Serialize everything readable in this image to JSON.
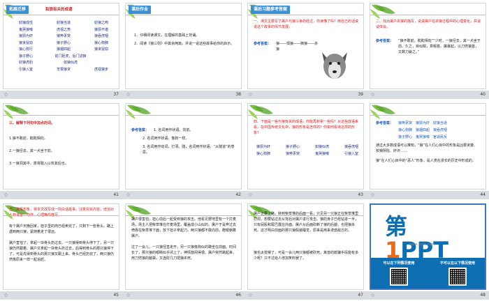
{
  "slides": [
    {
      "number": "37",
      "tag": "拓展迁移",
      "heading": "和狼有关的成语",
      "idioms": [
        [
          "豺狼成性",
          "豺狼当道",
          "豺狼之吻"
        ],
        [
          "鬼哭狼嚎",
          "虎视之势",
          "狼狈不堪"
        ],
        [
          "狼狈为奸",
          "狼奔豕突",
          "狼吞虎咽"
        ],
        [
          "狼贪鼠窃",
          "狼子野心",
          "狼心狗肺"
        ],
        [
          "狼心狗行",
          "狼烟四起",
          "狼贪鼠窃"
        ],
        [
          "狼子野心",
          "前门拒虎，后门进狼",
          ""
        ],
        [
          "豺狼虎豹",
          "如狼似虎",
          ""
        ],
        [
          "引狼入室",
          "羊狠狼贪",
          "虎视狼步"
        ]
      ],
      "idioms_col2": "如狼似虎"
    },
    {
      "number": "38",
      "tag": "课后作业",
      "lines": [
        "1．仔细阅读课文，在理解的基础上背诵。",
        "2．阅读《狼三则》中其余两篇，并说一说这些故事给你的启示。"
      ]
    },
    {
      "number": "39",
      "tag": "课后习题参考答案",
      "question": "一、课文主要写了屠户与狼斗争的经过，你读懂了吗？用自己的话说说这个故事的情节发展。",
      "answer_label": "参考答案：",
      "answer": "狼——惧狼——御狼——杀狼"
    },
    {
      "number": "40",
      "tag": "",
      "question": "二、找出屠户杀狼的描写，说说屠户在杀狼过程中的心理变化，并谈谈体会。",
      "answer_label": "参考答案：",
      "answer": "“狼不敢前，眈眈相向”“少时，一狼径去，其一犬坐于前。久之，目似瞑，意暇甚。屠暴起，以刀劈狼首，又数刀毙之。”"
    },
    {
      "number": "41",
      "tag": "",
      "question": "三、解释下列句中加点的词。",
      "lines": [
        "1.狼不敢前，眈眈相向。",
        "2.一狼径去，其一犬坐于前。",
        "3.一狼洞其中，意将隧入以攻其后也。"
      ]
    },
    {
      "number": "42",
      "tag": "",
      "answer_label": "参考答案：",
      "lines": [
        "1. 名词用作状语，向前。",
        "2. 名词用作状语，像狗一样。",
        "3. 名词用作动词，打洞。隧，名词用作状语，“从隧道”的意思。"
      ]
    },
    {
      "number": "43",
      "tag": "",
      "question": "四、下面是一些与狼有关的成语，你能再积累一些吗？从这些成语来看，在中国传统文化中，狼的形象是怎样的？你如何看待这样的形象？",
      "idioms": [
        [
          "狼狈为奸",
          "狼子野心",
          "如狼似虎",
          "狼吞虎咽"
        ],
        [
          "狼心狗肺",
          "狼奔豕突",
          "鬼哭狼嚎",
          "引狼入室"
        ]
      ]
    },
    {
      "number": "44",
      "tag": "",
      "answer_label": "参考答案：",
      "lines": [
        "狼奔豕突　狼狈为奸　豺狼当道",
        "狼心狗肺　狼烟四起　狼吞虎咽",
        "狼子野心　鬼哭狼嚎　官逼民反",
        "通过大多数成语可以推知，“狼”在人们心目中的形象是凶狠贪婪、狡猾阴险、奸诈……",
        "狼“在人们心目中的“恶人”形象，是人类在漫长的历史中形成的。"
      ]
    },
    {
      "number": "45",
      "tag": "",
      "question": "五、发挥想象，将本文改写成一则白话故事。注意充实内容，增加对人物语言、动作、心理等的描写。",
      "lines": [
        "有个屠户天晚回家，担子里的肉已经卖完了，只剩下一些骨头。路上遇到两只狼，紧随着走了很远。",
        "屠户害怕了，拿起一块骨头扔过去。一只狼得到骨头停下了，另一只狼仍然跟着。屠户又拿起一块骨头扔过去，后得到骨头的那只狼停下了，可是先得到骨头的那只狼又跟上来。骨头已经扔完了，两只狼仍然像原来一样一起追赶。"
      ]
    },
    {
      "number": "46",
      "tag": "",
      "lines": [
        "屠户很害怕，担心前后一起受到狼的攻击。他看见野地里有一个打麦场，场主人把柴草堆在打麦场里，覆盖成小山似的。屠户于是奔过去倚靠在柴草堆下面，放下担子拿起刀。两只狼都不敢向前，瞪眼朝着屠户。",
        "过了一会儿，一只狼径直走开，另一只狼像狗似的蹲坐在前面。时间长了，那只狼的眼睛似乎闭上了，神情悠闲得很。屠户突然跳起来，用刀劈狼的脑袋，又连砍几刀把狼杀死。"
      ]
    },
    {
      "number": "47",
      "tag": "",
      "lines": [
        "屠户正要上路，转到柴草堆的后面一看，只见另一只狼正在柴草堆里打洞，想要钻过去从背后对屠户进行攻击。狼的身子已经钻进一半，只有屁股和尾巴露在外面。屠户从后面砍断了狼的后腿，也把狼杀死。这才明白前面的那只狼假装睡觉，原来是用来诱惑敌方的。",
        "狼也太狡猾了，可是一会儿两只狼都被砍死，禽兽的欺骗手段能有多少呢？只不过给人增加笑料罢了。"
      ]
    },
    {
      "number": "48",
      "logo_prefix": "第",
      "logo_digit": "1",
      "logo_suffix": "PPT",
      "logo_sub": "www.1ppt.com",
      "left_heading": "可以在下列情况使用",
      "right_heading": "不可以在以下情况使用"
    }
  ]
}
